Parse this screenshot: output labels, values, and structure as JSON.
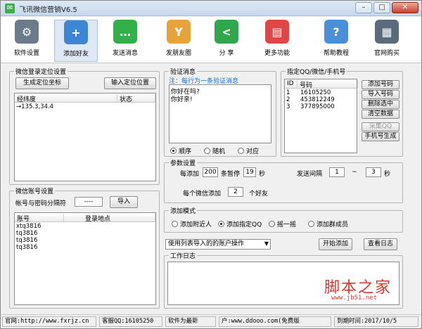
{
  "window": {
    "title": "飞讯微信营销V6.5"
  },
  "toolbar": {
    "items": [
      {
        "label": "软件设置",
        "icon": "gear-icon",
        "color": "#6b7b8c"
      },
      {
        "label": "添加好友",
        "icon": "add-user-icon",
        "color": "#3d86d6"
      },
      {
        "label": "发送消息",
        "icon": "chat-icon",
        "color": "#34b04a"
      },
      {
        "label": "发朋友圈",
        "icon": "moments-icon",
        "color": "#e8a23a"
      },
      {
        "label": "分  享",
        "icon": "share-icon",
        "color": "#2fa74a"
      },
      {
        "label": "更多功能",
        "icon": "more-icon",
        "color": "#e04646"
      },
      {
        "label": "帮助教程",
        "icon": "help-icon",
        "color": "#4a90d9"
      },
      {
        "label": "官网购买",
        "icon": "buy-icon",
        "color": "#5a6b7d"
      }
    ]
  },
  "location": {
    "group_title": "微信登录定位设置",
    "gen_button": "生成定位坐标",
    "input_button": "输入定位位置",
    "columns": [
      "经纬度",
      "状态"
    ],
    "rows": [
      "→135.3,34.4"
    ]
  },
  "verify": {
    "group_title": "验证消息",
    "hint": "注：每行为一条验证消息",
    "lines": [
      "你好在吗?",
      "你好亲!"
    ],
    "modes": [
      "顺序",
      "随机",
      "对应"
    ],
    "selected_mode": 0
  },
  "qq": {
    "group_title": "指定QQ/微信/手机号",
    "columns": [
      "ID",
      "号码"
    ],
    "rows": [
      {
        "id": "1",
        "num": "16105250"
      },
      {
        "id": "2",
        "num": "453812249"
      },
      {
        "id": "3",
        "num": "377895000"
      }
    ],
    "buttons": [
      "添加号码",
      "导入号码",
      "删除选中",
      "清空数据",
      "采集QQ",
      "手机号生成"
    ]
  },
  "params": {
    "group_title": "参数设置",
    "add_each_label": "每添加",
    "add_each": "200",
    "pause_label": "条暂停",
    "pause": "19",
    "sec1": "秒",
    "interval_label": "发送间隔",
    "interval_min": "1",
    "tilde": "~",
    "interval_max": "3",
    "sec2": "秒",
    "per_wechat_label": "每个微信添加",
    "per_wechat": "2",
    "friends_label": "个好友"
  },
  "add_mode": {
    "group_title": "添加模式",
    "options": [
      "添加附近人",
      "添加指定QQ",
      "摇一摇",
      "添加群成员"
    ],
    "selected": 1
  },
  "action": {
    "select_value": "使用列表导入的的账户操作",
    "start_button": "开始添加",
    "log_button": "查看日志"
  },
  "log": {
    "group_title": "工作日志"
  },
  "account": {
    "group_title": "微信账号设置",
    "sep_label": "帐号与密码分隔符",
    "sep_value": "----",
    "import_button": "导入",
    "columns": [
      "账号",
      "登录地点"
    ],
    "rows": [
      "xtq3816",
      "tq3816",
      "tq3816",
      "tq3816"
    ]
  },
  "status": {
    "site": "官网:http://www.fxrjz.cn",
    "qq": "客服QQ:16105250",
    "version": "软件为最新",
    "user": "户:www.ddooo.com(免费版",
    "expire": "到期时间:2017/10/5"
  },
  "watermark": {
    "text": "脚本之家",
    "url": "www.jb51.net"
  }
}
